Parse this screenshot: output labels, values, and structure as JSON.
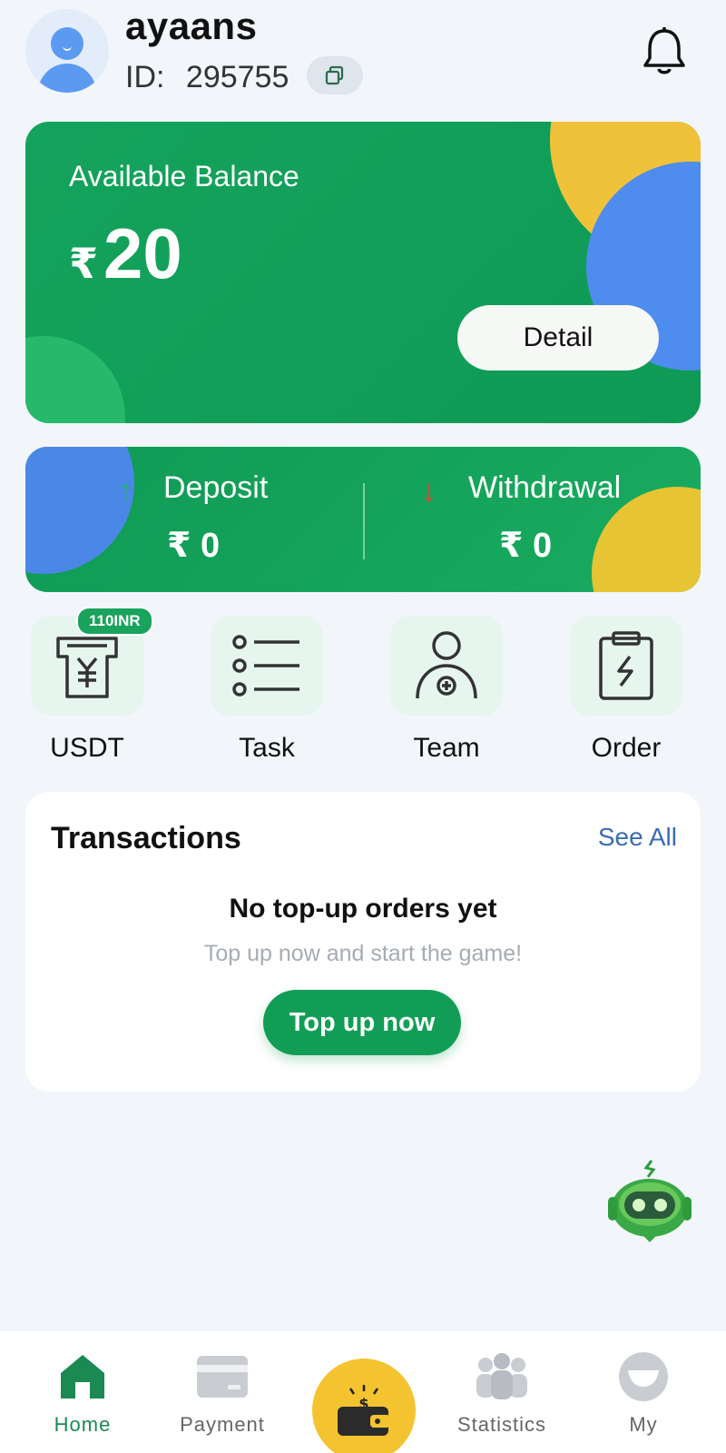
{
  "header": {
    "username": "ayaans",
    "id_label": "ID:",
    "id_value": "295755"
  },
  "balance": {
    "label": "Available Balance",
    "currency": "₹",
    "amount": "20",
    "detail_button": "Detail"
  },
  "flows": {
    "deposit": {
      "label": "Deposit",
      "value": "₹ 0"
    },
    "withdrawal": {
      "label": "Withdrawal",
      "value": "₹ 0"
    }
  },
  "quick_actions": [
    {
      "label": "USDT",
      "badge": "110INR",
      "icon": "receipt-yuan-icon"
    },
    {
      "label": "Task",
      "icon": "list-icon"
    },
    {
      "label": "Team",
      "icon": "add-user-icon"
    },
    {
      "label": "Order",
      "icon": "clipboard-bolt-icon"
    }
  ],
  "transactions": {
    "title": "Transactions",
    "see_all": "See All",
    "empty_title": "No top-up orders yet",
    "empty_subtitle": "Top up now and start the game!",
    "topup_button": "Top up now"
  },
  "bottom_nav": [
    {
      "label": "Home",
      "icon": "home-icon",
      "active": true
    },
    {
      "label": "Payment",
      "icon": "card-icon"
    },
    {
      "label": "",
      "icon": "wallet-icon"
    },
    {
      "label": "Statistics",
      "icon": "people-icon"
    },
    {
      "label": "My",
      "icon": "profile-icon"
    }
  ],
  "colors": {
    "primary_green": "#119d55",
    "accent_yellow": "#f0c23a",
    "accent_blue": "#4f8cef",
    "withdraw_arrow": "#d9473b",
    "link_blue": "#3a6bb5"
  }
}
